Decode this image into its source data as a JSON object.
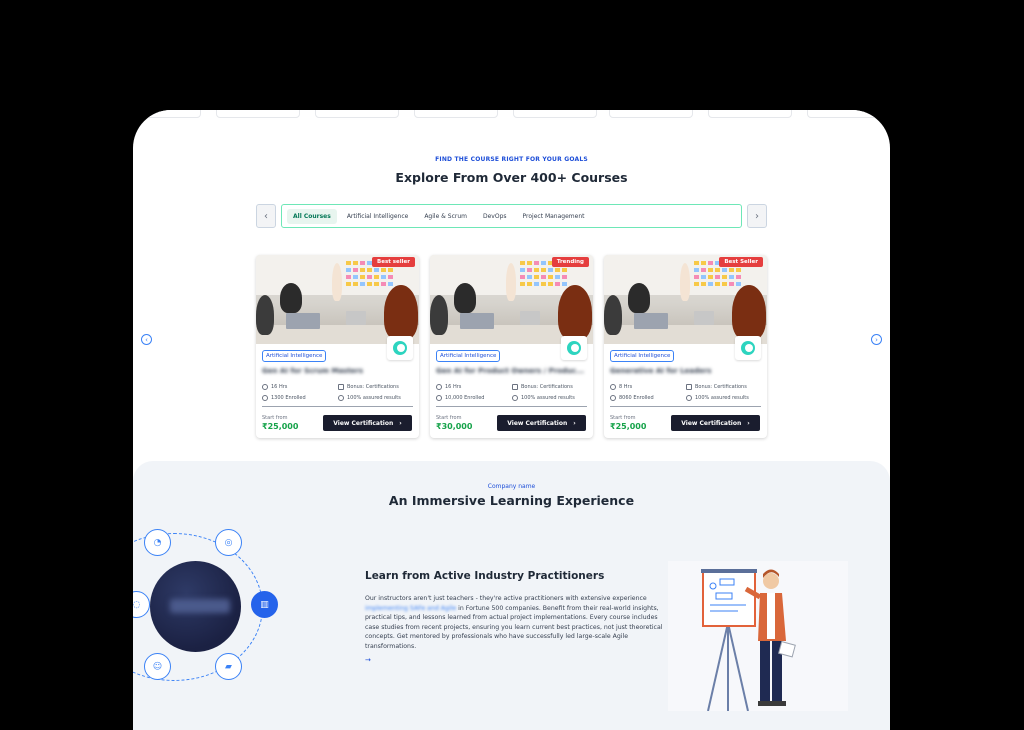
{
  "header": {
    "eyebrow": "FIND THE COURSE RIGHT FOR YOUR GOALS",
    "title": "Explore From Over 400+ Courses"
  },
  "tabs": [
    {
      "label": "All Courses",
      "active": true
    },
    {
      "label": "Artificial Intelligence",
      "active": false
    },
    {
      "label": "Agile & Scrum",
      "active": false
    },
    {
      "label": "DevOps",
      "active": false
    },
    {
      "label": "Project Management",
      "active": false
    }
  ],
  "nav": {
    "prev_icon": "chevron-left-icon",
    "next_icon": "chevron-right-icon",
    "prev": "‹",
    "next": "›"
  },
  "cards": [
    {
      "badge": "Best seller",
      "category": "Artificial Intelligence",
      "title": "Gen AI for Scrum Masters",
      "duration": "16 Hrs",
      "bonus": "Bonus: Certifications",
      "enrolled": "1300 Enrolled",
      "assured": "100% assured results",
      "start_label": "Start from",
      "price": "₹25,000",
      "cta": "View Certification"
    },
    {
      "badge": "Trending",
      "category": "Artificial Intelligence",
      "title": "Gen AI for Product Owners / Produc...",
      "duration": "16 Hrs",
      "bonus": "Bonus: Certifications",
      "enrolled": "10,000 Enrolled",
      "assured": "100% assured results",
      "start_label": "Start from",
      "price": "₹30,000",
      "cta": "View Certification"
    },
    {
      "badge": "Best Seller",
      "category": "Artificial Intelligence",
      "title": "Generative AI for Leaders",
      "duration": "8 Hrs",
      "bonus": "Bonus: Certifications",
      "enrolled": "8060 Enrolled",
      "assured": "100% assured results",
      "start_label": "Start from",
      "price": "₹25,000",
      "cta": "View Certification"
    }
  ],
  "section2": {
    "eyebrow": "Company name",
    "title": "An Immersive Learning Experience",
    "feature_title": "Learn from Active Industry Practitioners",
    "feature_text_1": "Our instructors aren't just teachers - they're active practitioners with extensive experience",
    "feature_text_hl": "implementing SAFe and Agile",
    "feature_text_2": " in Fortune 500 companies. Benefit from their real-world insights, practical tips, and lessons learned from actual project implementations. Every course includes case studies from recent projects, ensuring you learn current best practices, not just theoretical concepts. Get mentored by professionals who have successfully led large-scale Agile transformations.",
    "arrow": "→"
  },
  "colors": {
    "accent": "#1d4ed8",
    "badge": "#e53e3e",
    "price": "#16a34a",
    "button": "#1a1d2e"
  }
}
